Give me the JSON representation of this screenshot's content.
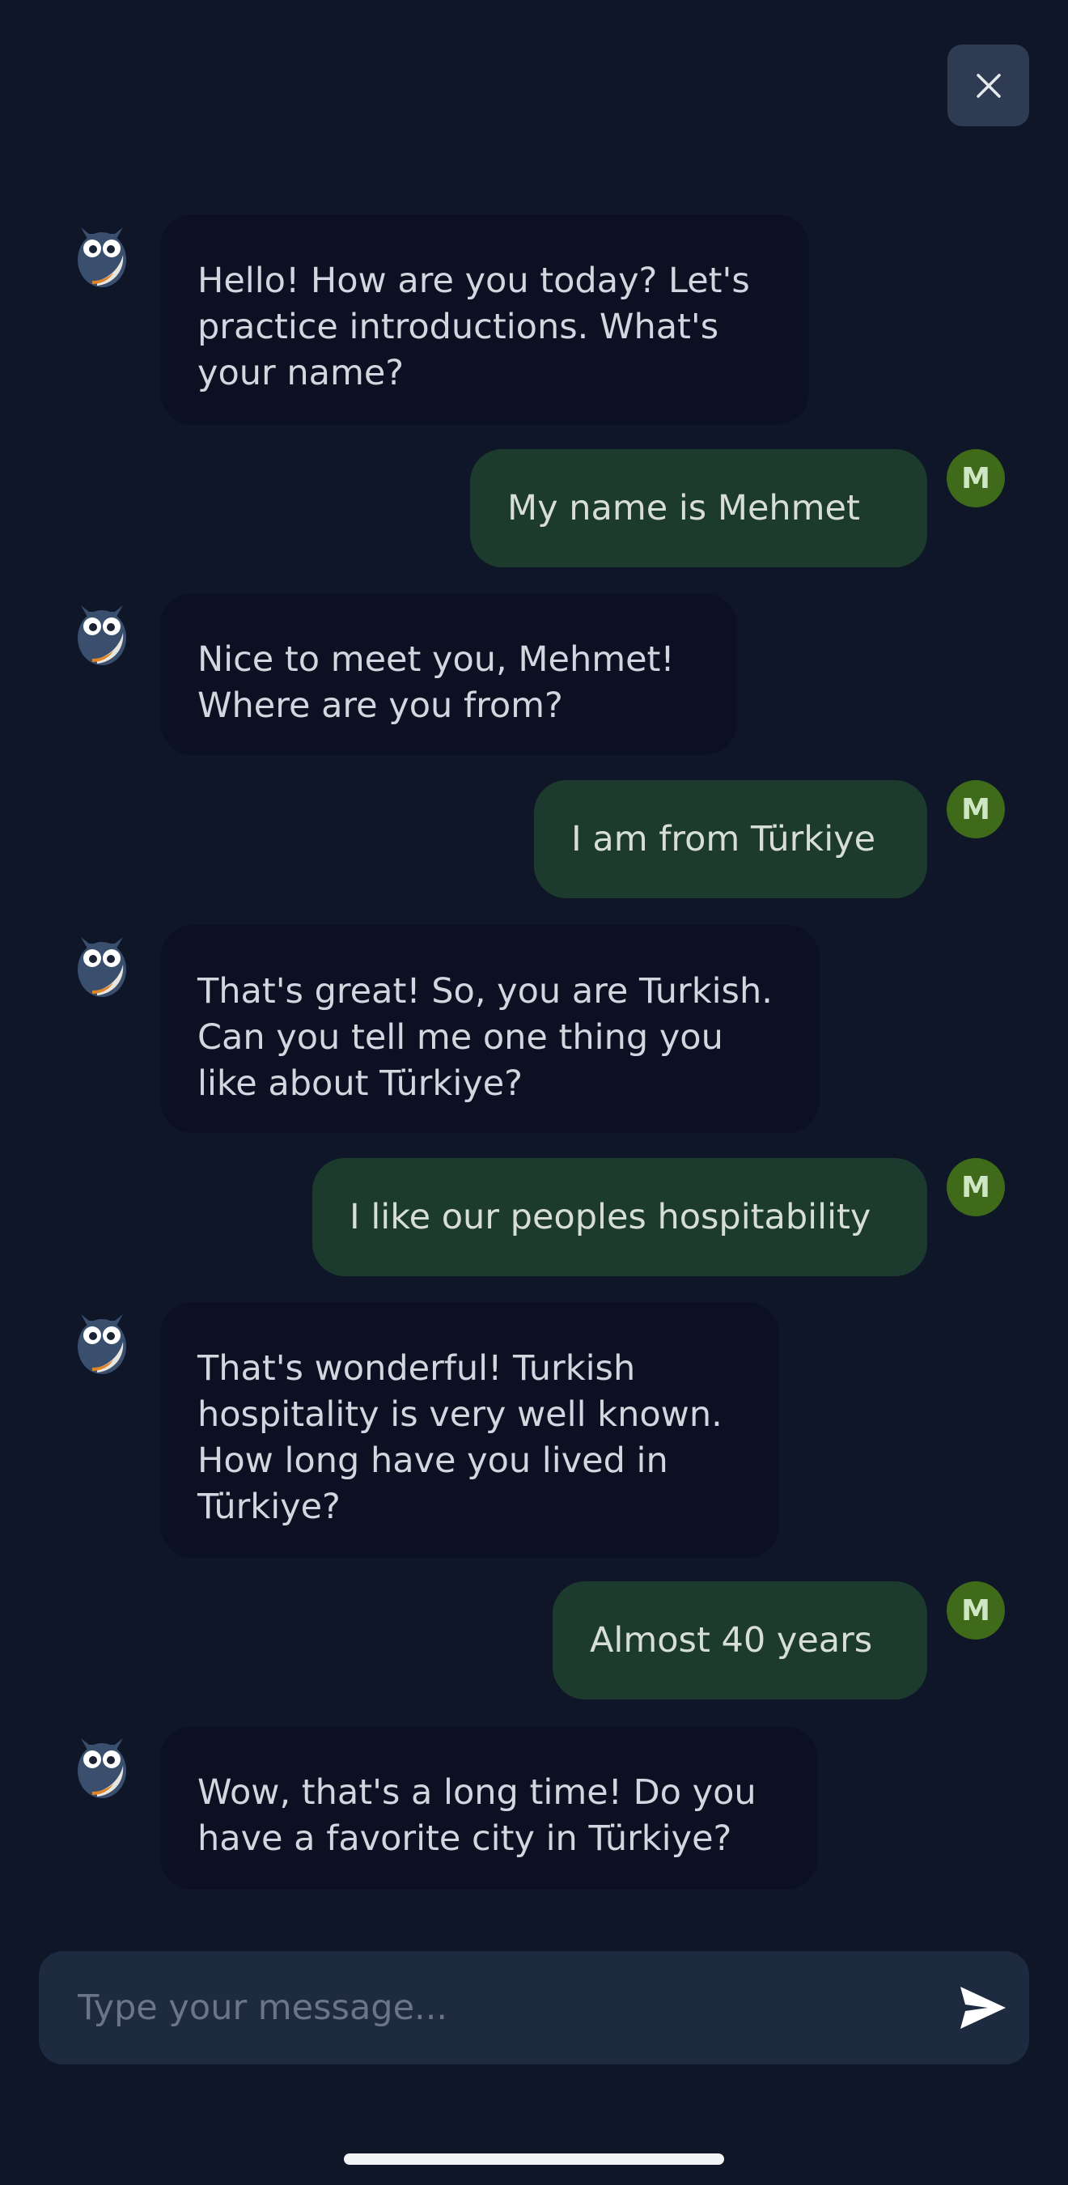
{
  "chat": {
    "messages": [
      {
        "from": "bot",
        "lines": [
          "Hello! How are you today? Let's",
          "practice introductions. What's",
          "your name?"
        ]
      },
      {
        "from": "user",
        "avatar_initial": "M",
        "text": "My name is Mehmet"
      },
      {
        "from": "bot",
        "lines": [
          "Nice to meet you, Mehmet!",
          "Where are you from?"
        ]
      },
      {
        "from": "user",
        "avatar_initial": "M",
        "text": "I am from Türkiye"
      },
      {
        "from": "bot",
        "lines": [
          "That's great! So, you are Turkish.",
          "Can you tell me one thing you",
          "like about Türkiye?"
        ]
      },
      {
        "from": "user",
        "avatar_initial": "M",
        "text": "I like our peoples hospitability"
      },
      {
        "from": "bot",
        "lines": [
          "That's wonderful! Turkish",
          "hospitality is very well known.",
          "How long have you lived in",
          "Türkiye?"
        ]
      },
      {
        "from": "user",
        "avatar_initial": "M",
        "text": "Almost 40 years"
      },
      {
        "from": "bot",
        "lines": [
          "Wow, that's a long time! Do you",
          "have a favorite city in Türkiye?"
        ]
      }
    ]
  },
  "composer": {
    "placeholder": "Type your message..."
  },
  "icons": {
    "close": "close-icon",
    "send": "send-icon",
    "bot_avatar": "owl-icon"
  },
  "colors": {
    "background": "#0e1628",
    "bot_bubble": "#0b1122",
    "user_bubble": "#1c3a2d",
    "user_avatar": "#3e6a1a",
    "close_button": "#2f3b52",
    "composer": "#1e2a3f"
  }
}
